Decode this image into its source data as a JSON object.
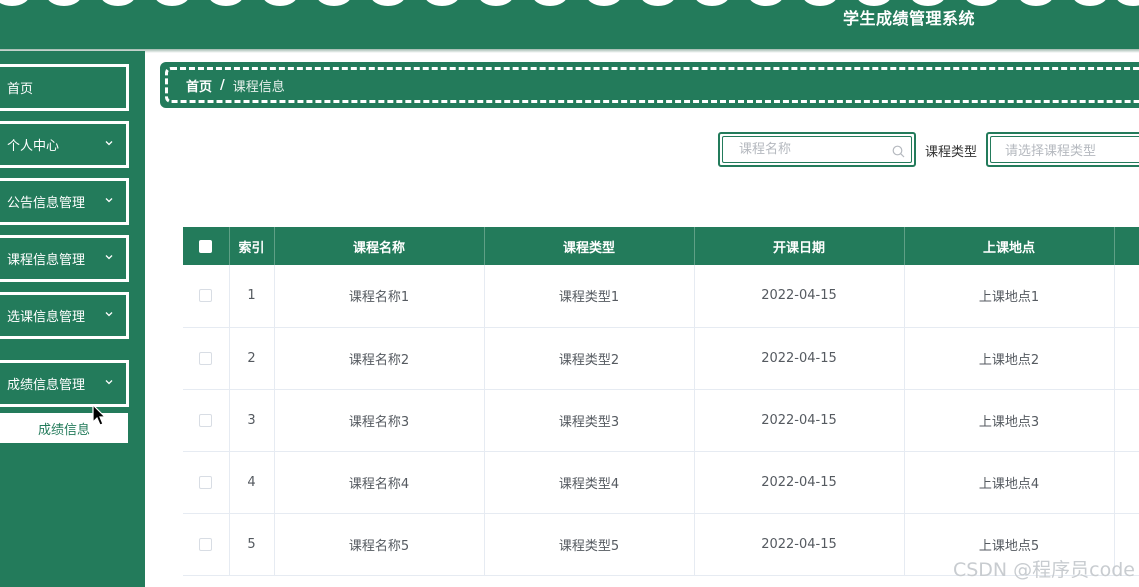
{
  "header": {
    "title": "学生成绩管理系统"
  },
  "sidebar": {
    "items": [
      {
        "label": "首页"
      },
      {
        "label": "个人中心"
      },
      {
        "label": "公告信息管理"
      },
      {
        "label": "课程信息管理"
      },
      {
        "label": "选课信息管理"
      },
      {
        "label": "成绩信息管理"
      }
    ],
    "submenu": {
      "label": "成绩信息"
    }
  },
  "breadcrumb": {
    "home": "首页",
    "separator": "/",
    "current": "课程信息"
  },
  "search": {
    "course_name_placeholder": "课程名称",
    "course_type_label": "课程类型",
    "course_type_placeholder": "请选择课程类型"
  },
  "table": {
    "headers": [
      "索引",
      "课程名称",
      "课程类型",
      "开课日期",
      "上课地点"
    ],
    "rows": [
      {
        "index": "1",
        "name": "课程名称1",
        "type": "课程类型1",
        "date": "2022-04-15",
        "place": "上课地点1"
      },
      {
        "index": "2",
        "name": "课程名称2",
        "type": "课程类型2",
        "date": "2022-04-15",
        "place": "上课地点2"
      },
      {
        "index": "3",
        "name": "课程名称3",
        "type": "课程类型3",
        "date": "2022-04-15",
        "place": "上课地点3"
      },
      {
        "index": "4",
        "name": "课程名称4",
        "type": "课程类型4",
        "date": "2022-04-15",
        "place": "上课地点4"
      },
      {
        "index": "5",
        "name": "课程名称5",
        "type": "课程类型5",
        "date": "2022-04-15",
        "place": "上课地点5"
      }
    ]
  },
  "watermark": "CSDN @程序员code",
  "colors": {
    "primary": "#237b5b",
    "white": "#ffffff"
  }
}
